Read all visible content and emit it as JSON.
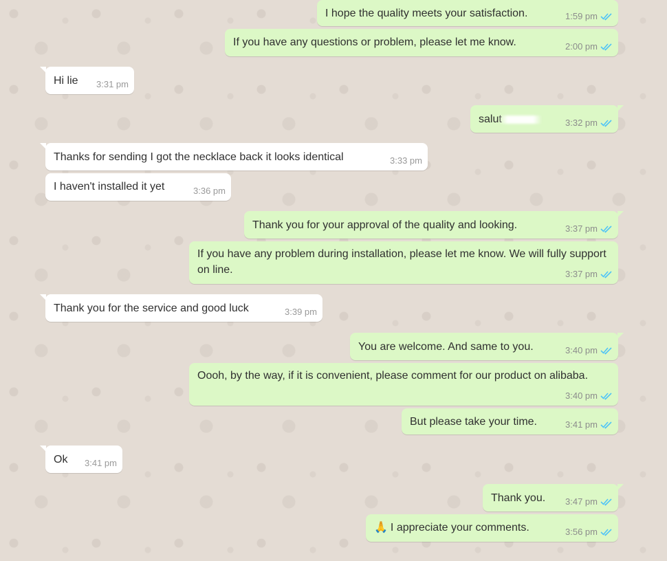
{
  "messages": [
    {
      "dir": "out",
      "text": "I hope the quality meets your satisfaction.",
      "time": "1:59 pm"
    },
    {
      "dir": "out",
      "text": "If you have any questions or problem,  please let me know.",
      "time": "2:00 pm"
    },
    {
      "dir": "in",
      "text": "Hi lie",
      "time": "3:31 pm"
    },
    {
      "dir": "out",
      "text": "salut",
      "time": "3:32 pm"
    },
    {
      "dir": "in",
      "text": "Thanks for sending I got the necklace back it looks identical",
      "time": "3:33 pm"
    },
    {
      "dir": "in",
      "text": "I haven't installed it yet",
      "time": "3:36 pm"
    },
    {
      "dir": "out",
      "text": "Thank you for your approval of the quality and looking.",
      "time": "3:37 pm"
    },
    {
      "dir": "out",
      "text": "If you have any problem during installation, please let me know. We will fully support on line.",
      "time": "3:37 pm"
    },
    {
      "dir": "in",
      "text": "Thank you for the service and good luck",
      "time": "3:39 pm"
    },
    {
      "dir": "out",
      "text": "You are welcome. And same to you.",
      "time": "3:40 pm"
    },
    {
      "dir": "out",
      "text": "Oooh, by the way, if it is convenient, please comment for our product on alibaba.",
      "time": "3:40 pm"
    },
    {
      "dir": "out",
      "text": "But please take your time.",
      "time": "3:41 pm"
    },
    {
      "dir": "in",
      "text": "Ok",
      "time": "3:41 pm"
    },
    {
      "dir": "out",
      "text": "Thank you.",
      "time": "3:47 pm"
    },
    {
      "dir": "out",
      "text": "I appreciate your comments.",
      "emoji": "🙏",
      "time": "3:56 pm"
    }
  ],
  "colors": {
    "outgoing_bubble": "#dcf8c6",
    "incoming_bubble": "#ffffff",
    "read_ticks": "#4fc3f7",
    "background": "#e5ddd5"
  },
  "icons": {
    "read_receipt": "double-check-icon",
    "reaction_emoji": "folded-hands-emoji"
  }
}
